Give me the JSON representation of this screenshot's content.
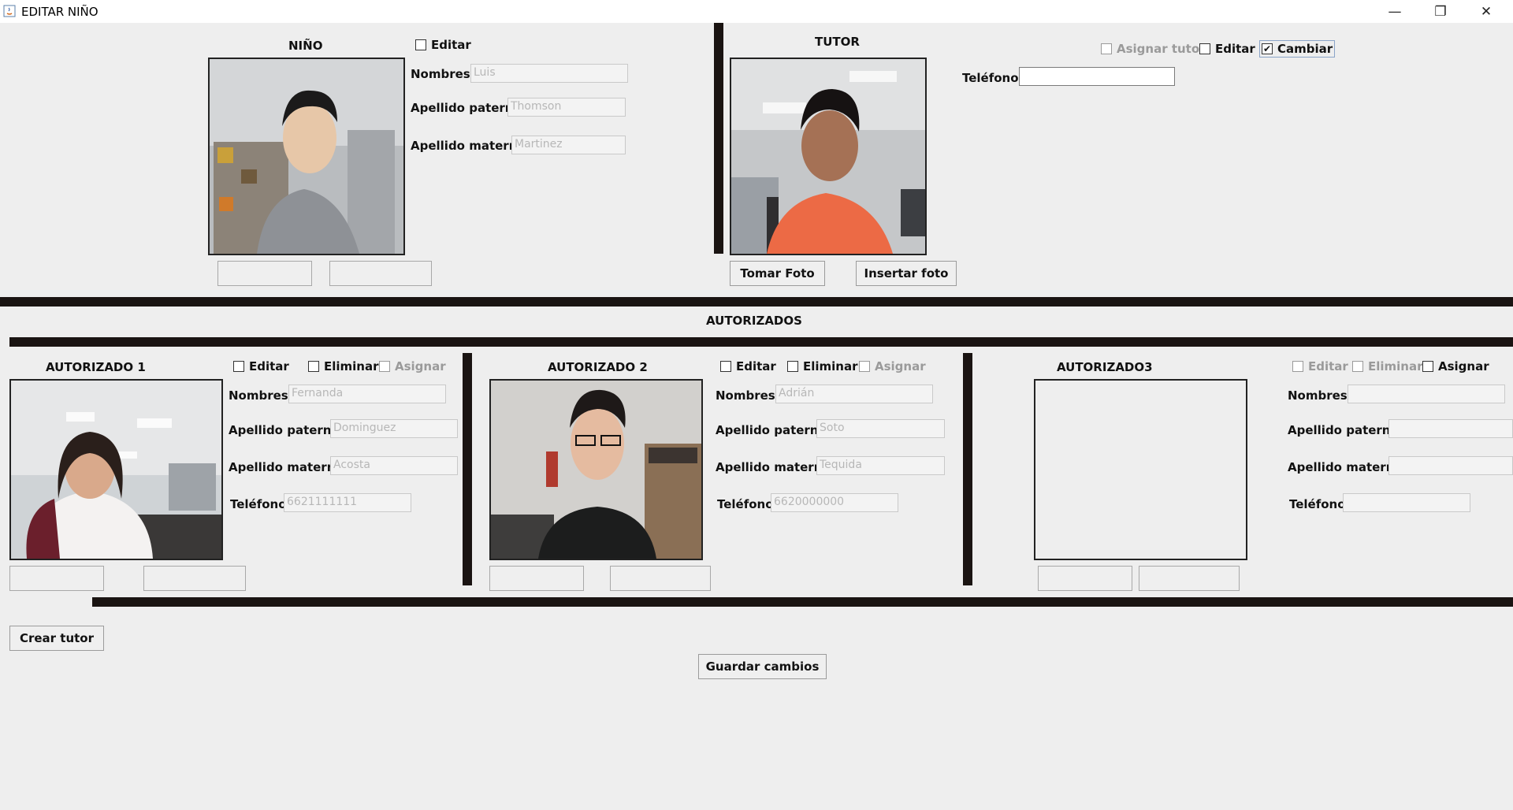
{
  "window": {
    "title": "EDITAR NIÑO",
    "controls": {
      "minimize": "—",
      "maximize": "❐",
      "close": "✕"
    }
  },
  "nino": {
    "heading": "NIÑO",
    "edit_label": "Editar",
    "labels": {
      "nombres": "Nombres:",
      "paterno": "Apellido paterno:",
      "materno": "Apellido materno:"
    },
    "values": {
      "nombres": "Luis",
      "paterno": "Thomson",
      "materno": "Martinez"
    }
  },
  "tutor": {
    "heading": "TUTOR",
    "asignar_label": "Asignar tutor",
    "edit_label": "Editar",
    "cambiar_label": "Cambiar",
    "telefono_label": "Teléfono:",
    "telefono_value": "",
    "tomar_foto": "Tomar Foto",
    "insertar_foto": "Insertar foto"
  },
  "autorizados_heading": "AUTORIZADOS",
  "autorizados": [
    {
      "heading": "AUTORIZADO 1",
      "edit_label": "Editar",
      "eliminar_label": "Eliminar",
      "asignar_label": "Asignar",
      "labels": {
        "nombres": "Nombres:",
        "paterno": "Apellido paterno:",
        "materno": "Apellido materno:",
        "telefono": "Teléfono:"
      },
      "values": {
        "nombres": "Fernanda",
        "paterno": "Dominguez",
        "materno": "Acosta",
        "telefono": "6621111111"
      }
    },
    {
      "heading": "AUTORIZADO 2",
      "edit_label": "Editar",
      "eliminar_label": "Eliminar",
      "asignar_label": "Asignar",
      "labels": {
        "nombres": "Nombres:",
        "paterno": "Apellido paterno:",
        "materno": "Apellido materno:",
        "telefono": "Teléfono:"
      },
      "values": {
        "nombres": "Adrián",
        "paterno": "Soto",
        "materno": "Tequida",
        "telefono": "6620000000"
      }
    },
    {
      "heading": "AUTORIZADO3",
      "edit_label": "Editar",
      "eliminar_label": "Eliminar",
      "asignar_label": "Asignar",
      "labels": {
        "nombres": "Nombres:",
        "paterno": "Apellido paterno:",
        "materno": "Apellido materno:",
        "telefono": "Teléfono:"
      },
      "values": {
        "nombres": "",
        "paterno": "",
        "materno": "",
        "telefono": ""
      }
    }
  ],
  "crear_tutor": "Crear tutor",
  "guardar_cambios": "Guardar cambios"
}
